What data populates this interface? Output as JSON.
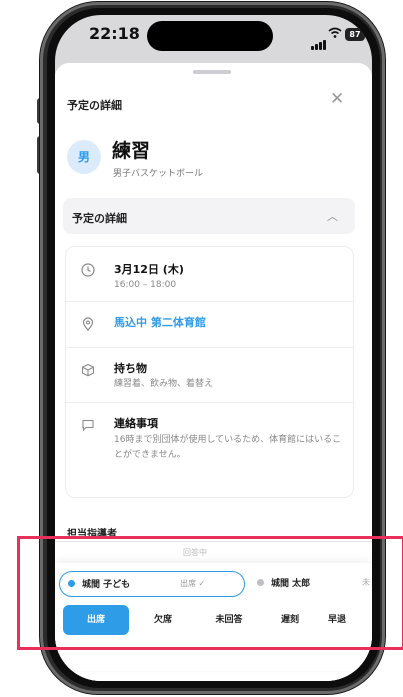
{
  "status_bar": {
    "time": "22:18",
    "battery": "87"
  },
  "sheet": {
    "title": "予定の詳細",
    "close_icon": "close-icon"
  },
  "event": {
    "badge": "男",
    "title": "練習",
    "team": "男子バスケットボール"
  },
  "details_section": {
    "label": "予定の詳細",
    "chevron": "chevron-up-icon"
  },
  "details": {
    "date": {
      "title": "3月12日 (木)",
      "time": "16:00 – 18:00"
    },
    "location": {
      "name": "馬込中 第二体育館"
    },
    "items": {
      "title": "持ち物",
      "value": "練習着、飲み物、着替え"
    },
    "notes": {
      "title": "連絡事項",
      "value": "16時まで別団体が使用しているため、体育館にはいることができません。"
    }
  },
  "staff": {
    "heading": "担当指導者"
  },
  "attendance": {
    "faded_label": "回答中",
    "participants": [
      {
        "name": "城間 子ども",
        "status": "出席 ✓",
        "selected": true
      },
      {
        "name": "城間 太郎",
        "status": "未"
      }
    ],
    "buttons": {
      "present": "出席",
      "absent": "欠席",
      "unanswered": "未回答",
      "late": "遅刻",
      "early": "早退"
    }
  },
  "colors": {
    "accent": "#2f9ce8",
    "highlight": "#e8305a"
  }
}
